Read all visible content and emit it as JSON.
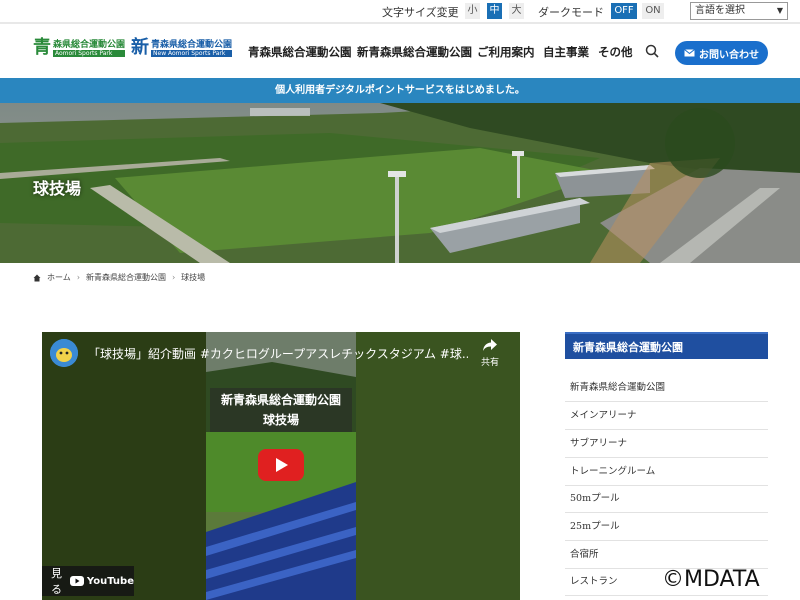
{
  "topbar": {
    "font_size_label": "文字サイズ変更",
    "font_sizes": [
      "小",
      "中",
      "大"
    ],
    "font_size_selected": "中",
    "dark_mode_label": "ダークモード",
    "dark_mode_off": "OFF",
    "dark_mode_on": "ON",
    "language_select": "言語を選択"
  },
  "logo": {
    "a_kanji": "青",
    "a_name": "森県総合運動公園",
    "a_en": "Aomori Sports Park",
    "b_kanji": "新",
    "b_name": "青森県総合運動公園",
    "b_en": "New Aomori Sports Park"
  },
  "nav": {
    "items": [
      "青森県総合運動公園",
      "新青森県総合運動公園",
      "ご利用案内",
      "自主事業",
      "その他"
    ],
    "contact": "お問い合わせ"
  },
  "announcement": "個人利用者デジタルポイントサービスをはじめました。",
  "hero": {
    "title": "球技場"
  },
  "breadcrumb": [
    "ホーム",
    "新青森県総合運動公園",
    "球技場"
  ],
  "video": {
    "title": "「球技場」紹介動画 #カクヒログループアスレチックスタジアム #球...",
    "overlay_line1": "新青森県総合運動公園",
    "overlay_line2": "球技場",
    "share": "共有",
    "watch_on": "見る",
    "youtube": "YouTube"
  },
  "sidebar": {
    "heading": "新青森県総合運動公園",
    "items": [
      "新青森県総合運動公園",
      "メインアリーナ",
      "サブアリーナ",
      "トレーニングルーム",
      "50mプール",
      "25mプール",
      "合宿所",
      "レストラン"
    ]
  },
  "watermark": "©MDATA",
  "colors": {
    "brand_blue": "#1a6fcc",
    "announce": "#2a86bf",
    "sidebar_head": "#1f4fa0",
    "logo_green": "#2a8a3a"
  }
}
